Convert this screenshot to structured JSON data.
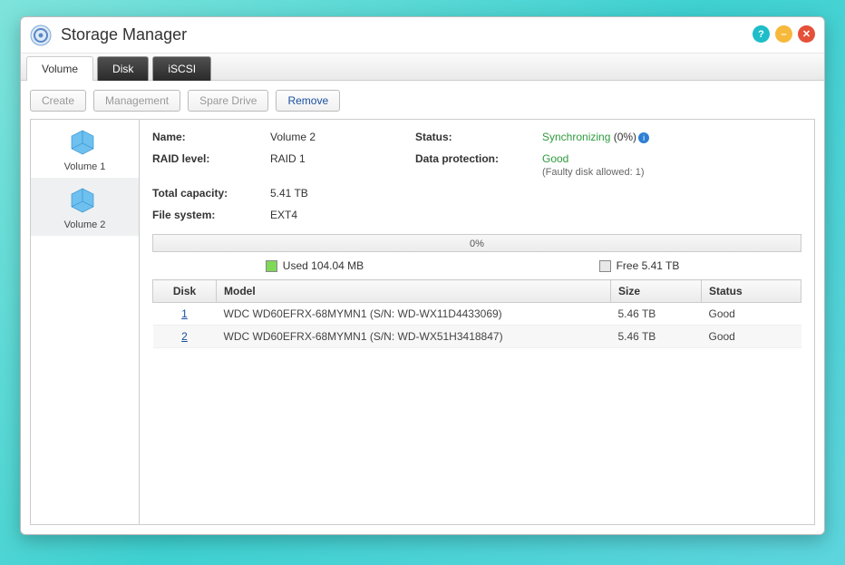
{
  "title": "Storage Manager",
  "tabs": [
    "Volume",
    "Disk",
    "iSCSI"
  ],
  "active_tab": 0,
  "toolbar": {
    "create": "Create",
    "management": "Management",
    "spare_drive": "Spare Drive",
    "remove": "Remove"
  },
  "sidebar": {
    "volumes": [
      {
        "label": "Volume 1"
      },
      {
        "label": "Volume 2"
      }
    ],
    "selected": 1
  },
  "details": {
    "labels": {
      "name": "Name:",
      "raid": "RAID level:",
      "capacity": "Total capacity:",
      "fs": "File system:",
      "status": "Status:",
      "protection": "Data protection:"
    },
    "name": "Volume 2",
    "raid": "RAID 1",
    "capacity": "5.41 TB",
    "fs": "EXT4",
    "status_text": "Synchronizing",
    "status_pct": "(0%)",
    "protection": "Good",
    "protection_note": "(Faulty disk allowed: 1)"
  },
  "usage": {
    "progress_text": "0%",
    "used_label": "Used 104.04 MB",
    "free_label": "Free 5.41 TB"
  },
  "table": {
    "headers": {
      "disk": "Disk",
      "model": "Model",
      "size": "Size",
      "status": "Status"
    },
    "rows": [
      {
        "disk": "1",
        "model": "WDC WD60EFRX-68MYMN1 (S/N: WD-WX11D4433069)",
        "size": "5.46 TB",
        "status": "Good"
      },
      {
        "disk": "2",
        "model": "WDC WD60EFRX-68MYMN1 (S/N: WD-WX51H3418847)",
        "size": "5.46 TB",
        "status": "Good"
      }
    ]
  }
}
